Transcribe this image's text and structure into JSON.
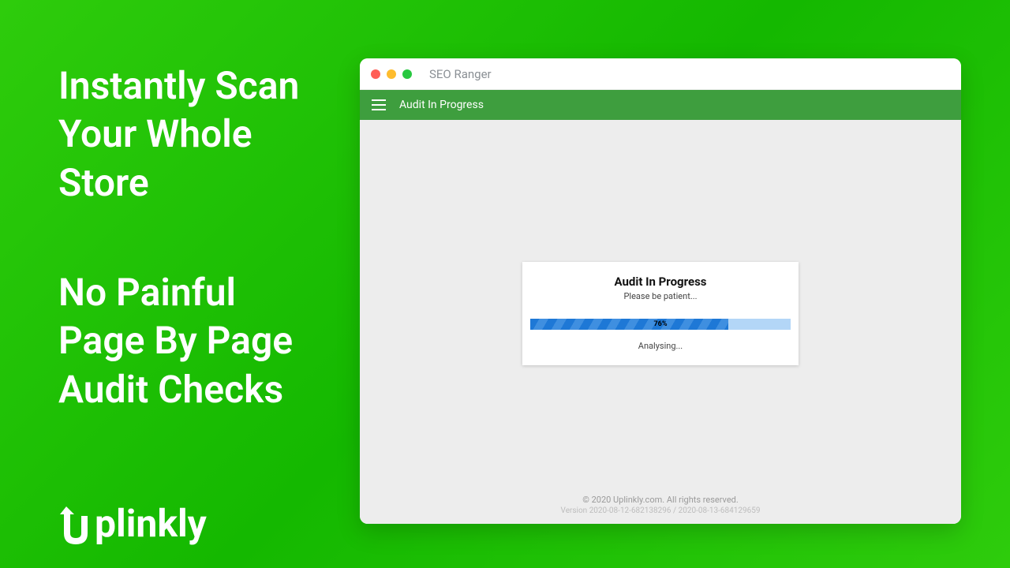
{
  "headline1": "Instantly Scan\nYour Whole\nStore",
  "headline2": "No Painful\nPage By Page\nAudit Checks",
  "brand": "plinkly",
  "window": {
    "title": "SEO Ranger",
    "appbar_title": "Audit In Progress"
  },
  "card": {
    "title": "Audit In Progress",
    "subtitle": "Please be patient...",
    "progress_percent": 76,
    "progress_label": "76%",
    "status": "Analysing..."
  },
  "footer": {
    "line1": "© 2020 Uplinkly.com. All rights reserved.",
    "line2": "Version 2020-08-12-682138296 / 2020-08-13-684129659"
  }
}
